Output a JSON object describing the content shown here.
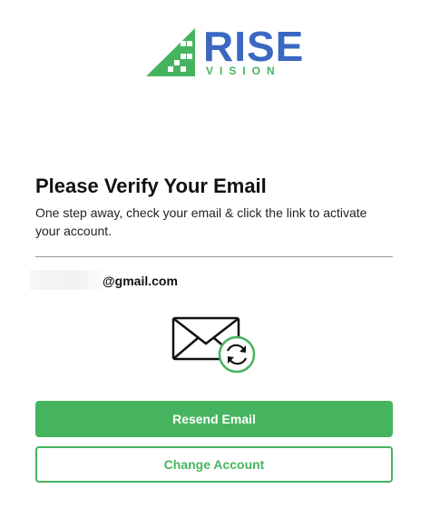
{
  "brand": {
    "name": "RISE",
    "tagline": "VISION",
    "blue": "#3a68c2",
    "green": "#46b45f"
  },
  "verify": {
    "title": "Please Verify Your Email",
    "message": "One step away, check your email & click the link to activate your account.",
    "email": "@gmail.com",
    "illustration_icon": "envelope-refresh-icon"
  },
  "actions": {
    "resend_label": "Resend Email",
    "change_label": "Change Account"
  }
}
